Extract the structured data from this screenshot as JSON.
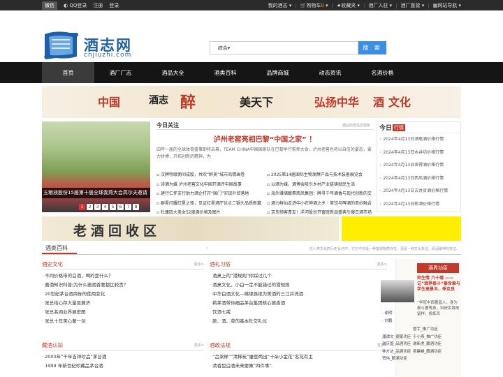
{
  "topbar": {
    "weixin": "微信",
    "qq": "QQ登录",
    "register": "注册",
    "login": "登录",
    "right": [
      "我的酒志",
      "购物车",
      "收藏夹",
      "酒厂入驻",
      "酒厂直营",
      "网站导航"
    ],
    "cart_count": "0"
  },
  "logo": {
    "cn": "酒志网",
    "en": "cnjiuzhi.com"
  },
  "search": {
    "option": "综合",
    "button": "搜 索",
    "placeholder": ""
  },
  "nav": [
    "首页",
    "酒厂厂志",
    "酒品大全",
    "酒类百科",
    "品牌商城",
    "动态资讯",
    "名酒价格"
  ],
  "banner1": {
    "p1": "中国",
    "p2": "酒志",
    "p3": "醉",
    "p4": "美天下",
    "p5": "弘扬中华",
    "p6": "酒",
    "p7": "文化"
  },
  "slider": {
    "caption": "五粮液股份15届第十届全球奏燕大会高尔夫邀请",
    "pages": [
      "1",
      "2",
      "3",
      "4",
      "5",
      "6",
      "7",
      "8"
    ]
  },
  "news": {
    "title": "今日关注",
    "more": "酒业动态信息更新",
    "headline": "泸州老窖亮相巴黎“中国之家” ！",
    "summary": "四年一届的全球体育盛事即将启幕，TEAM CHINA中国国家队在巴黎举行誓师大会，泸州老窖也将以自信的姿态，奋力拼搏，开拓创新的精神，为",
    "left": [
      "汉牌特级佣间成股，共欢“醉美”城市风情画卷",
      "诗酒为媒 泸州老窖文化中国开酒评中国故事",
      "建行仁怀支行助力酒企打开“国门”实现外贸落地",
      "群星闪耀红星之夜，见证红星酒厅优点二锅头品质新篇",
      "杜康四大美女52度酒价格及图片"
    ],
    "right": [
      "2025第14届国际生物发酵产品与技术装备展览会",
      "以酒为媒，酒博会吸引乡村产业链铸就民生活",
      "海外赚储酿素西凤集团：牌寻千年酒香与现代创新的交",
      "酒力鲜仙走进中小农神酒之乡｜茶饮与啤酒的奇妙融合",
      "京东频客青友！洋河股份开窗既新品盛典引爆日酒市场"
    ]
  },
  "today": {
    "title": "今日",
    "badge": "行情",
    "items": [
      "2024年4月13日酒瓶酒价格行情",
      "2024年4月13日水井坊价格行情",
      "2024年4月13日舍得酒价格行情",
      "2024年4月13日西凤酒价格行情",
      "2024年4月13日古井贡酒价格行情",
      "2024年4月13日郎酒价格行情"
    ]
  },
  "banner2": {
    "text": "老酒回收区"
  },
  "section": {
    "title": "酒类百科",
    "arrow": "‹",
    "desc": "在人类文化的历史长河中，它已不仅是一种客观物质存在，更是一种文化象征，即酒精神的象征。"
  },
  "boxes": [
    {
      "title": "酒史文化",
      "more": "更多>",
      "items": [
        "不同价格带的白酒，喝的是什么？",
        "酱酒知识科普|为什么酱酒香要都比较贵？",
        "20世纪茅台酒商标的使用变化",
        "张总结心存大量恩兼济",
        "张总名闻业界展宏图",
        "张总十年苦心著一剑"
      ]
    },
    {
      "title": "酒礼习俗",
      "more": "更多>",
      "items": [
        "酒桌上的“潜规则”你踩过几个",
        "酒桌文化，小白一定不能错过的潜规则",
        "中华白酒文化—佛缘族视为美酒的三江并流酒",
        "鹈茅酒带你细品茅台集团核心酱香酒",
        "饮酒七戒",
        "颜、酒、菜的基本社交礼仪"
      ]
    },
    {
      "title": "藏酒认知",
      "more": "更多>",
      "items": [
        "2000年“千年吉祥珍品”茅台酒",
        "1999 年新世纪珍藏品茅台酒"
      ]
    },
    {
      "title": "酒政法规",
      "more": "更多>",
      "items": [
        "“吕梁样”“清稀炭”屡登两出“十朵小金花”名花有主",
        "清香型白酒未来要做“四件事”"
      ]
    }
  ],
  "honor": {
    "title": "酒界功臣",
    "name_title": "师生情 六十载 —— 记“酒界泰斗”秦含章与学生高景炎、季克良",
    "desc": "“学冠中西著昌人，身为泰斗著等身，科研实践地留样，修炼百",
    "names": [
      "谢明",
      "刘鹏"
    ],
    "list": [
      [
        "潘谭文_德家功臣",
        "于小燕_推广功臣"
      ],
      [
        "谢庆国_品酒功臣",
        "谢新虎_酿酒功臣"
      ],
      [
        "钟方达_品酒功臣",
        "吴建峰_酿酒功臣"
      ],
      [
        "赞伟_酿酒功臣",
        ""
      ]
    ],
    "extra": "管宇_推广功臣"
  },
  "colors": {
    "accent": "#c0392b",
    "nav_bg": "#151515",
    "search_btn": "#3a8ee6"
  }
}
